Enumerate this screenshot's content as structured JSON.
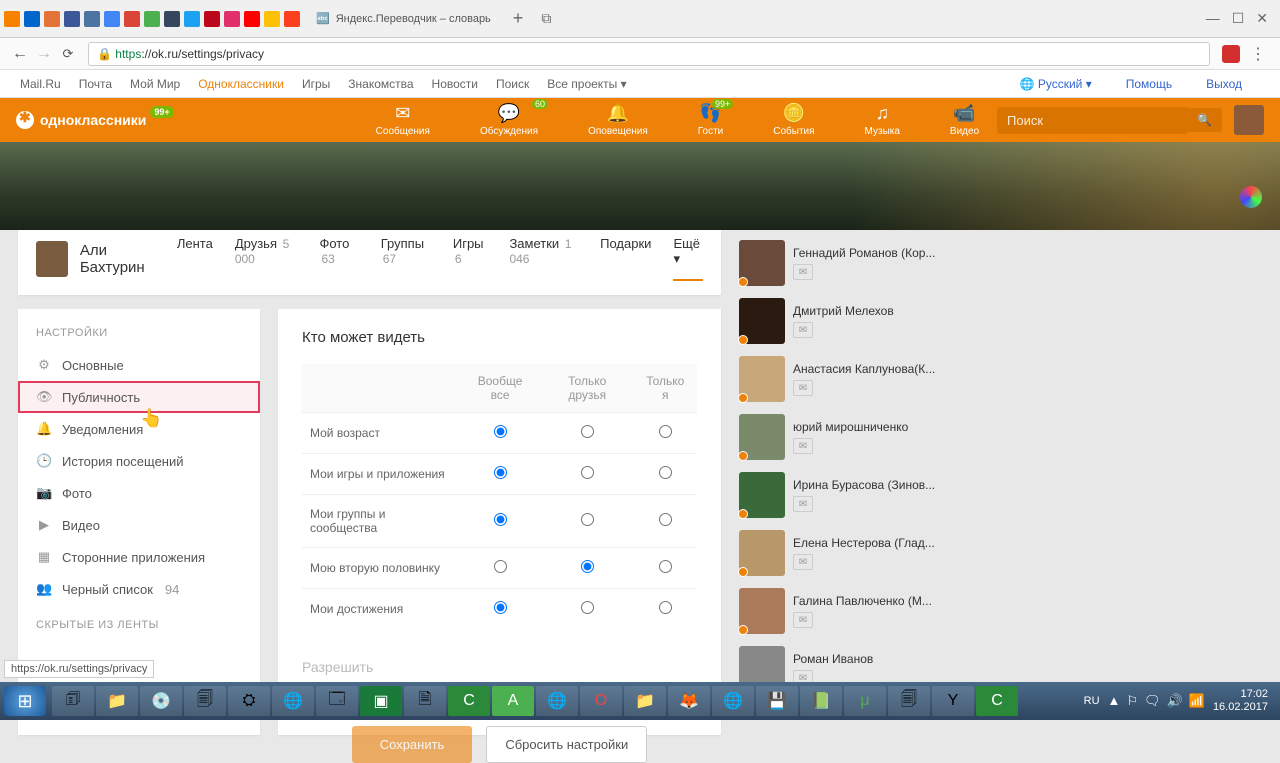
{
  "browser": {
    "tab_title": "Яндекс.Переводчик – словарь",
    "url_prefix": "https",
    "url_rest": "://ok.ru/settings/privacy",
    "status_url": "https://ok.ru/settings/privacy"
  },
  "portal": {
    "links": [
      "Mail.Ru",
      "Почта",
      "Мой Мир",
      "Одноклассники",
      "Игры",
      "Знакомства",
      "Новости",
      "Поиск",
      "Все проекты ▾"
    ],
    "active_index": 3,
    "lang": "Русский ▾",
    "help": "Помощь",
    "logout": "Выход"
  },
  "header": {
    "brand": "одноклассники",
    "badge": "99+",
    "nav": [
      {
        "label": "Сообщения",
        "badge": ""
      },
      {
        "label": "Обсуждения",
        "badge": "60"
      },
      {
        "label": "Оповещения",
        "badge": ""
      },
      {
        "label": "Гости",
        "badge": "99+"
      },
      {
        "label": "События",
        "badge": ""
      },
      {
        "label": "Музыка",
        "badge": ""
      },
      {
        "label": "Видео",
        "badge": ""
      }
    ],
    "nav_icons": [
      "✉",
      "💬",
      "🔔",
      "👣",
      "🪙",
      "♫",
      "📹"
    ],
    "search_placeholder": "Поиск"
  },
  "profile": {
    "name": "Али Бахтурин",
    "tabs": [
      {
        "label": "Лента",
        "count": ""
      },
      {
        "label": "Друзья",
        "count": "5 000"
      },
      {
        "label": "Фото",
        "count": "63"
      },
      {
        "label": "Группы",
        "count": "67"
      },
      {
        "label": "Игры",
        "count": "6"
      },
      {
        "label": "Заметки",
        "count": "1 046"
      },
      {
        "label": "Подарки",
        "count": ""
      },
      {
        "label": "Ещё ▾",
        "count": ""
      }
    ],
    "active_tab": 7
  },
  "sidebar": {
    "title": "НАСТРОЙКИ",
    "items": [
      {
        "icon": "⚙",
        "label": "Основные",
        "count": ""
      },
      {
        "icon": "👁",
        "label": "Публичность",
        "count": ""
      },
      {
        "icon": "🔔",
        "label": "Уведомления",
        "count": ""
      },
      {
        "icon": "🕒",
        "label": "История посещений",
        "count": ""
      },
      {
        "icon": "📷",
        "label": "Фото",
        "count": ""
      },
      {
        "icon": "▶",
        "label": "Видео",
        "count": ""
      },
      {
        "icon": "▦",
        "label": "Сторонние приложения",
        "count": ""
      },
      {
        "icon": "👥",
        "label": "Черный список",
        "count": "94"
      }
    ],
    "hidden_title": "СКРЫТЫЕ ИЗ ЛЕНТЫ",
    "highlight_index": 1
  },
  "privacy": {
    "title": "Кто может видеть",
    "columns": [
      "",
      "Вообще все",
      "Только друзья",
      "Только я"
    ],
    "rows": [
      {
        "label": "Мой возраст",
        "sel": 0
      },
      {
        "label": "Мои игры и приложения",
        "sel": 0
      },
      {
        "label": "Мои группы и сообщества",
        "sel": 0
      },
      {
        "label": "Мою вторую половинку",
        "sel": 1
      },
      {
        "label": "Мои достижения",
        "sel": 0
      }
    ],
    "next_section": "Разрешить",
    "save": "Сохранить",
    "reset": "Сбросить настройки"
  },
  "friends": [
    "Геннадий Романов (Кор...",
    "Дмитрий Мелехов",
    "Анастасия Каплунова(К...",
    "юрий мирошниченко",
    "Ирина Бурасова (Зинов...",
    "Елена Нестерова (Глад...",
    "Галина Павлюченко (М...",
    "Роман Иванов"
  ],
  "taskbar": {
    "lang": "RU",
    "time": "17:02",
    "date": "16.02.2017"
  }
}
